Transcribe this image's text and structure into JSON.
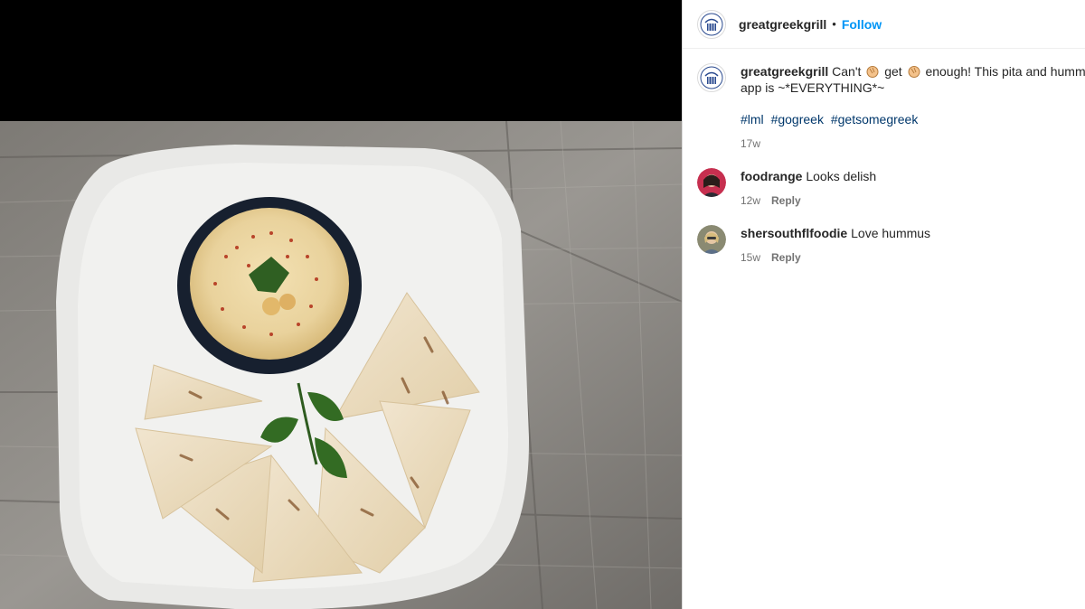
{
  "post": {
    "account": {
      "username": "greatgreekgrill",
      "follow_label": "Follow",
      "separator": "•"
    },
    "caption": {
      "username": "greatgreekgrill",
      "part1": "Can't",
      "part2": "get",
      "part3": "enough! This pita and hummus",
      "line2": "app is ~*EVERYTHING*~",
      "emoji": "clapping-hands-emoji",
      "hashtags": [
        "#lml",
        "#gogreek",
        "#getsomegreek"
      ],
      "time": "17w"
    },
    "comments": [
      {
        "username": "foodrange",
        "text": "Looks delish",
        "time": "12w",
        "reply_label": "Reply"
      },
      {
        "username": "shersouthflfoodie",
        "text": "Love hummus",
        "time": "15w",
        "reply_label": "Reply"
      }
    ]
  },
  "photo": {
    "subject": "hummus-and-pita-plate",
    "colors": {
      "wood": "#8f8f8c",
      "plate": "#ececec",
      "hummus": "#e8cf9a"
    }
  },
  "colors": {
    "link": "#0095f6",
    "hashtag": "#00376b",
    "muted": "#737373",
    "text": "#262626"
  }
}
